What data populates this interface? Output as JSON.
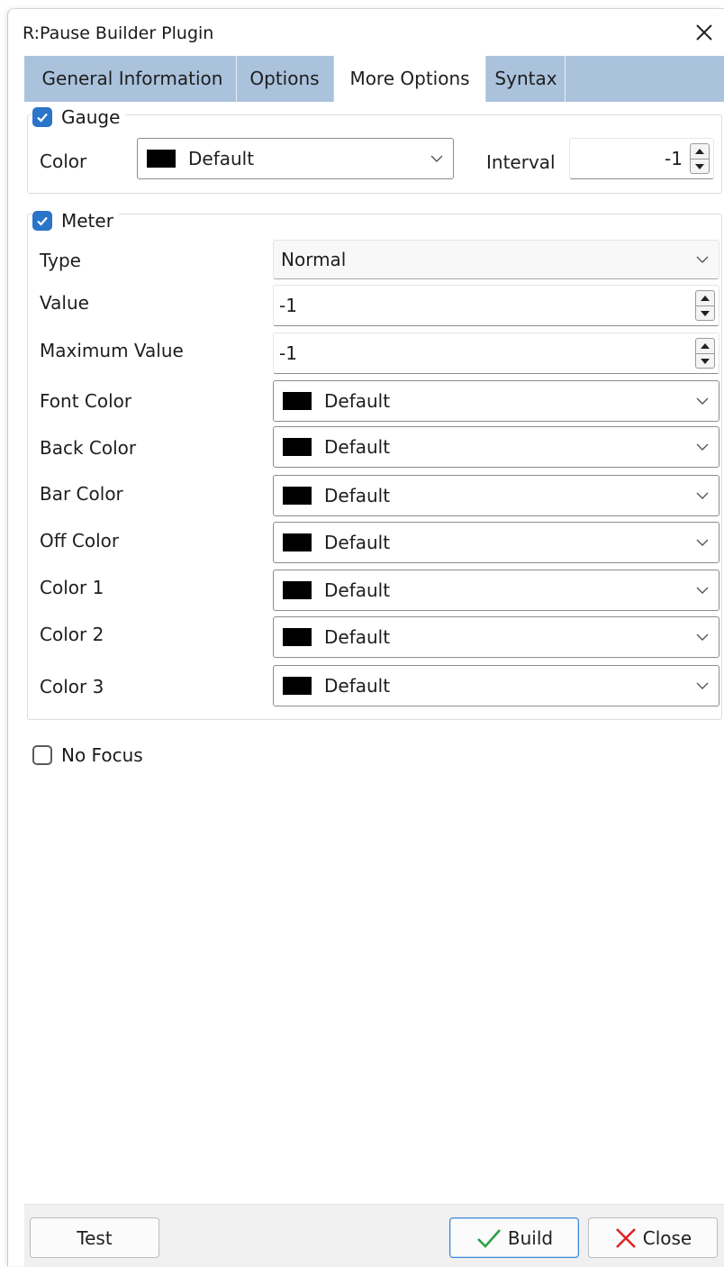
{
  "window": {
    "title": "R:Pause Builder Plugin"
  },
  "tabs": [
    {
      "label": "General Information",
      "active": false
    },
    {
      "label": "Options",
      "active": false
    },
    {
      "label": "More Options",
      "active": true
    },
    {
      "label": "Syntax",
      "active": false
    }
  ],
  "gauge": {
    "label": "Gauge",
    "checked": true,
    "color_label": "Color",
    "color_value": "Default",
    "interval_label": "Interval",
    "interval_value": "-1"
  },
  "meter": {
    "label": "Meter",
    "checked": true,
    "type_label": "Type",
    "type_value": "Normal",
    "value_label": "Value",
    "value_value": "-1",
    "max_label": "Maximum Value",
    "max_value": "-1",
    "font_color_label": "Font Color",
    "font_color_value": "Default",
    "back_color_label": "Back Color",
    "back_color_value": "Default",
    "bar_color_label": "Bar Color",
    "bar_color_value": "Default",
    "off_color_label": "Off Color",
    "off_color_value": "Default",
    "color1_label": "Color 1",
    "color1_value": "Default",
    "color2_label": "Color 2",
    "color2_value": "Default",
    "color3_label": "Color 3",
    "color3_value": "Default"
  },
  "no_focus": {
    "label": "No Focus",
    "checked": false
  },
  "buttons": {
    "test": "Test",
    "build": "Build",
    "close": "Close"
  },
  "colors": {
    "tab_bar": "#aac2dc",
    "checkbox_accent": "#2a74c9",
    "swatch": "#000000",
    "build_icon": "#2ea043",
    "close_icon": "#e02424",
    "primary_border": "#3a86d6"
  },
  "icons": {
    "window_close": "close-icon",
    "checkmark": "checkmark-icon",
    "dropdown": "chevron-down-icon",
    "spin": "spin-arrows-icon",
    "build": "check-icon",
    "close": "x-icon"
  }
}
